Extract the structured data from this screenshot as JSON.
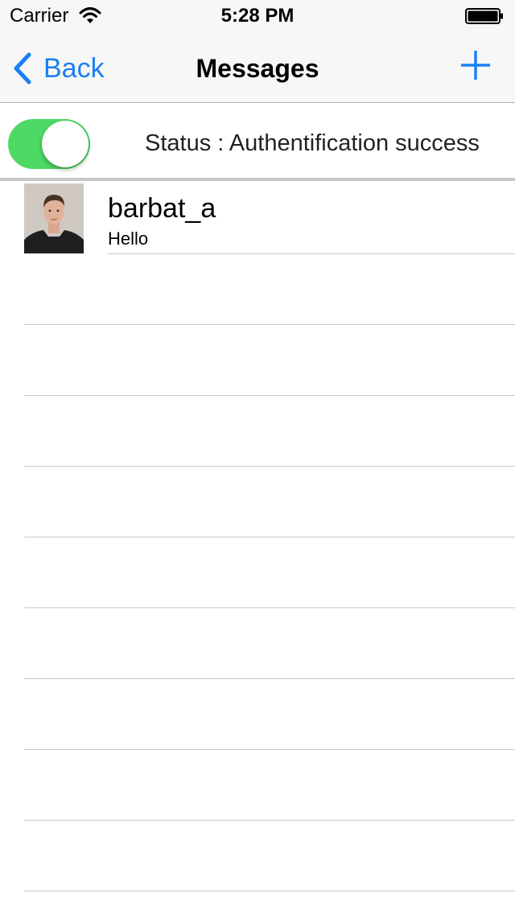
{
  "status_bar": {
    "carrier": "Carrier",
    "time": "5:28 PM",
    "icons": [
      "wifi-icon",
      "battery-icon"
    ]
  },
  "nav": {
    "back_label": "Back",
    "title": "Messages",
    "add_icon": "plus-icon"
  },
  "status_row": {
    "toggle_on": true,
    "status_text": "Status : Authentification success"
  },
  "messages": [
    {
      "name": "barbat_a",
      "message": "Hello",
      "avatar": "user-photo"
    }
  ],
  "colors": {
    "accent": "#1a80f5",
    "toggle_on": "#4cd964",
    "separator": "#c8c7cc",
    "navbar_bg": "#f7f7f7"
  }
}
